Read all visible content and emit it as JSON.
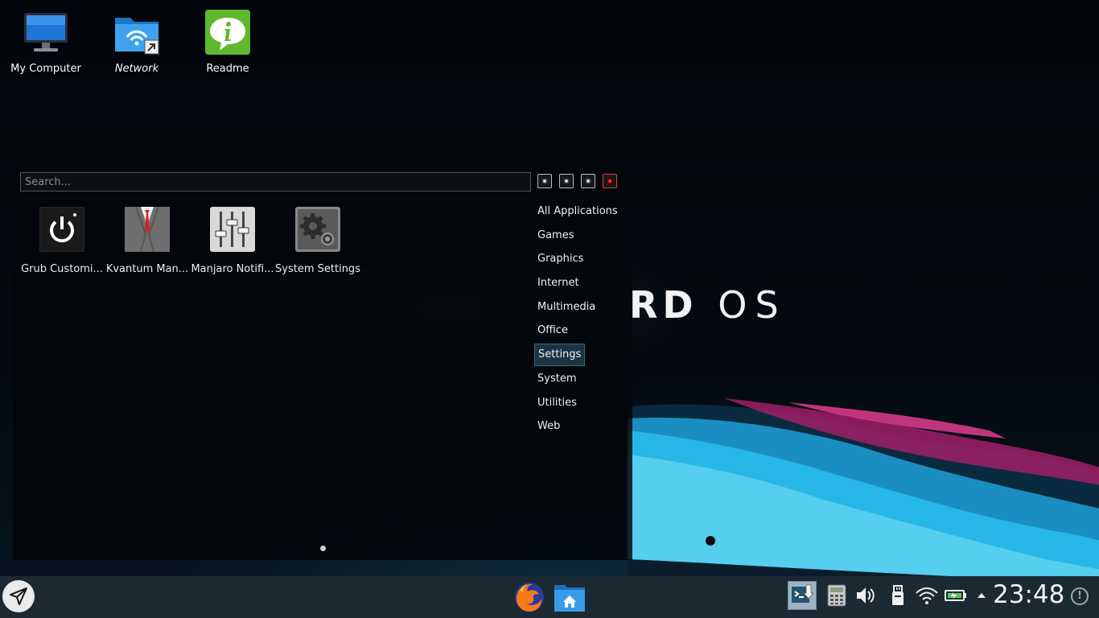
{
  "desktop": {
    "icons": [
      {
        "label": "My Computer",
        "icon": "monitor-icon"
      },
      {
        "label": "Network",
        "icon": "network-folder-icon"
      },
      {
        "label": "Readme",
        "icon": "info-icon"
      }
    ],
    "wallpaper_text": {
      "bold": "RD",
      "regular": "OS"
    }
  },
  "launcher": {
    "search_placeholder": "Search...",
    "power_buttons": [
      "lock-icon",
      "logout-icon",
      "restart-icon",
      "shutdown-icon"
    ],
    "apps": [
      {
        "label": "Grub Customi...",
        "icon": "power-icon"
      },
      {
        "label": "Kvantum Man...",
        "icon": "suit-icon"
      },
      {
        "label": "Manjaro Notifi...",
        "icon": "mixer-icon"
      },
      {
        "label": "System Settings",
        "icon": "gears-icon"
      }
    ],
    "categories": [
      "All Applications",
      "Games",
      "Graphics",
      "Internet",
      "Multimedia",
      "Office",
      "Settings",
      "System",
      "Utilities",
      "Web"
    ],
    "active_category": "Settings"
  },
  "taskbar": {
    "apps": [
      "firefox-icon",
      "home-folder-icon"
    ],
    "tray": [
      "terminal-download-icon",
      "calculator-icon",
      "volume-icon",
      "usb-icon",
      "wifi-icon",
      "battery-icon",
      "expand-arrow-icon"
    ],
    "clock": "23:48",
    "notification_symbol": "!"
  },
  "colors": {
    "taskbar_bg": "#1b2933",
    "active_category_bg": "#1b3342",
    "accent_cyan": "#2ab8e0",
    "accent_magenta": "#b0206a"
  }
}
